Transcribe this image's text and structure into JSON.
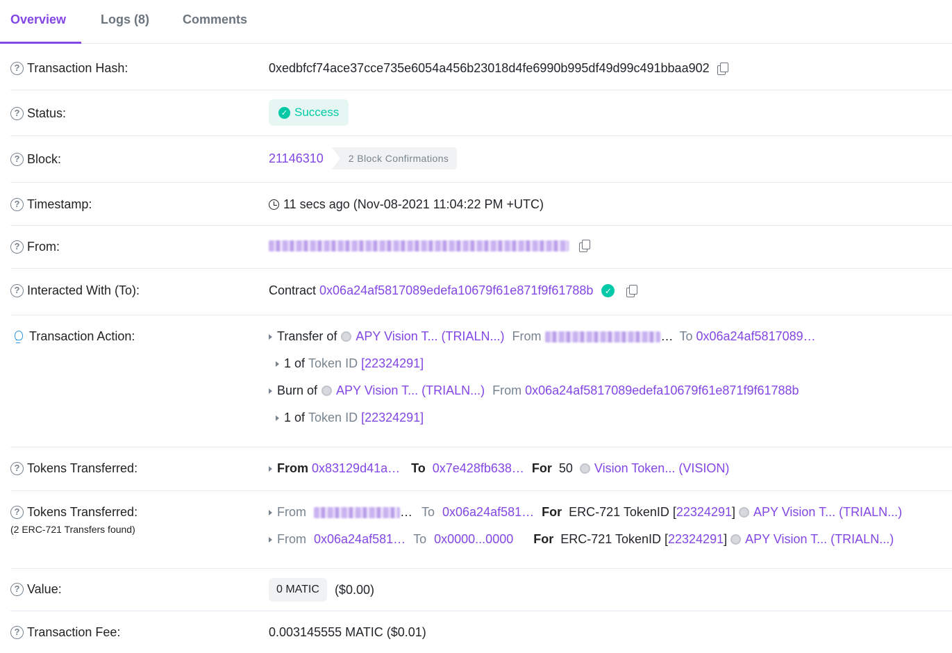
{
  "tabs": [
    {
      "label": "Overview"
    },
    {
      "label": "Logs (8)"
    },
    {
      "label": "Comments"
    }
  ],
  "rows": {
    "tx_hash": {
      "label": "Transaction Hash:",
      "value": "0xedbfcf74ace37cce735e6054a456b23018d4fe6990b995df49d99c491bbaa902"
    },
    "status": {
      "label": "Status:",
      "value": "Success"
    },
    "block": {
      "label": "Block:",
      "value": "21146310",
      "confirmations": "2 Block Confirmations"
    },
    "timestamp": {
      "label": "Timestamp:",
      "value": "11 secs ago (Nov-08-2021 11:04:22 PM +UTC)"
    },
    "from": {
      "label": "From:"
    },
    "to": {
      "label": "Interacted With (To):",
      "prefix": "Contract",
      "address": "0x06a24af5817089edefa10679f61e871f9f61788b"
    },
    "action": {
      "label": "Transaction Action:",
      "transfer": {
        "verb": "Transfer of",
        "token": "APY Vision T... (TRIALN...)",
        "from_label": "From",
        "ellipsis": "…",
        "to_label": "To",
        "to_addr": "0x06a24af5817089…"
      },
      "transfer_sub": {
        "qty": "1",
        "of": "of",
        "token_id_label": "Token ID",
        "token_id": "[22324291]"
      },
      "burn": {
        "verb": "Burn of",
        "token": "APY Vision T... (TRIALN...)",
        "from_label": "From",
        "from_addr": "0x06a24af5817089edefa10679f61e871f9f61788b"
      },
      "burn_sub": {
        "qty": "1",
        "of": "of",
        "token_id_label": "Token ID",
        "token_id": "[22324291]"
      }
    },
    "tokens1": {
      "label": "Tokens Transferred:",
      "from_label": "From",
      "from_addr": "0x83129d41a…",
      "to_label": "To",
      "to_addr": "0x7e428fb638…",
      "for_label": "For",
      "amount": "50",
      "token": "Vision Token... (VISION)"
    },
    "tokens2": {
      "label": "Tokens Transferred:",
      "sub": "(2 ERC-721 Transfers found)",
      "line1": {
        "from_label": "From",
        "from_ellipsis": "…",
        "to_label": "To",
        "to_addr": "0x06a24af581…",
        "for_label": "For",
        "std": "ERC-721 TokenID",
        "token_id": "22324291",
        "token": "APY Vision T... (TRIALN...)"
      },
      "line2": {
        "from_label": "From",
        "from_addr": "0x06a24af581…",
        "to_label": "To",
        "to_addr": "0x0000...0000",
        "for_label": "For",
        "std": "ERC-721 TokenID",
        "token_id": "22324291",
        "token": "APY Vision T... (TRIALN...)"
      }
    },
    "value": {
      "label": "Value:",
      "amount": "0 MATIC",
      "usd": "($0.00)"
    },
    "fee": {
      "label": "Transaction Fee:",
      "value": "0.003145555 MATIC ($0.01)"
    }
  },
  "colors": {
    "accent": "#8247e5",
    "success": "#00c9a7",
    "muted": "#77838f",
    "border": "#e7eaf3"
  }
}
